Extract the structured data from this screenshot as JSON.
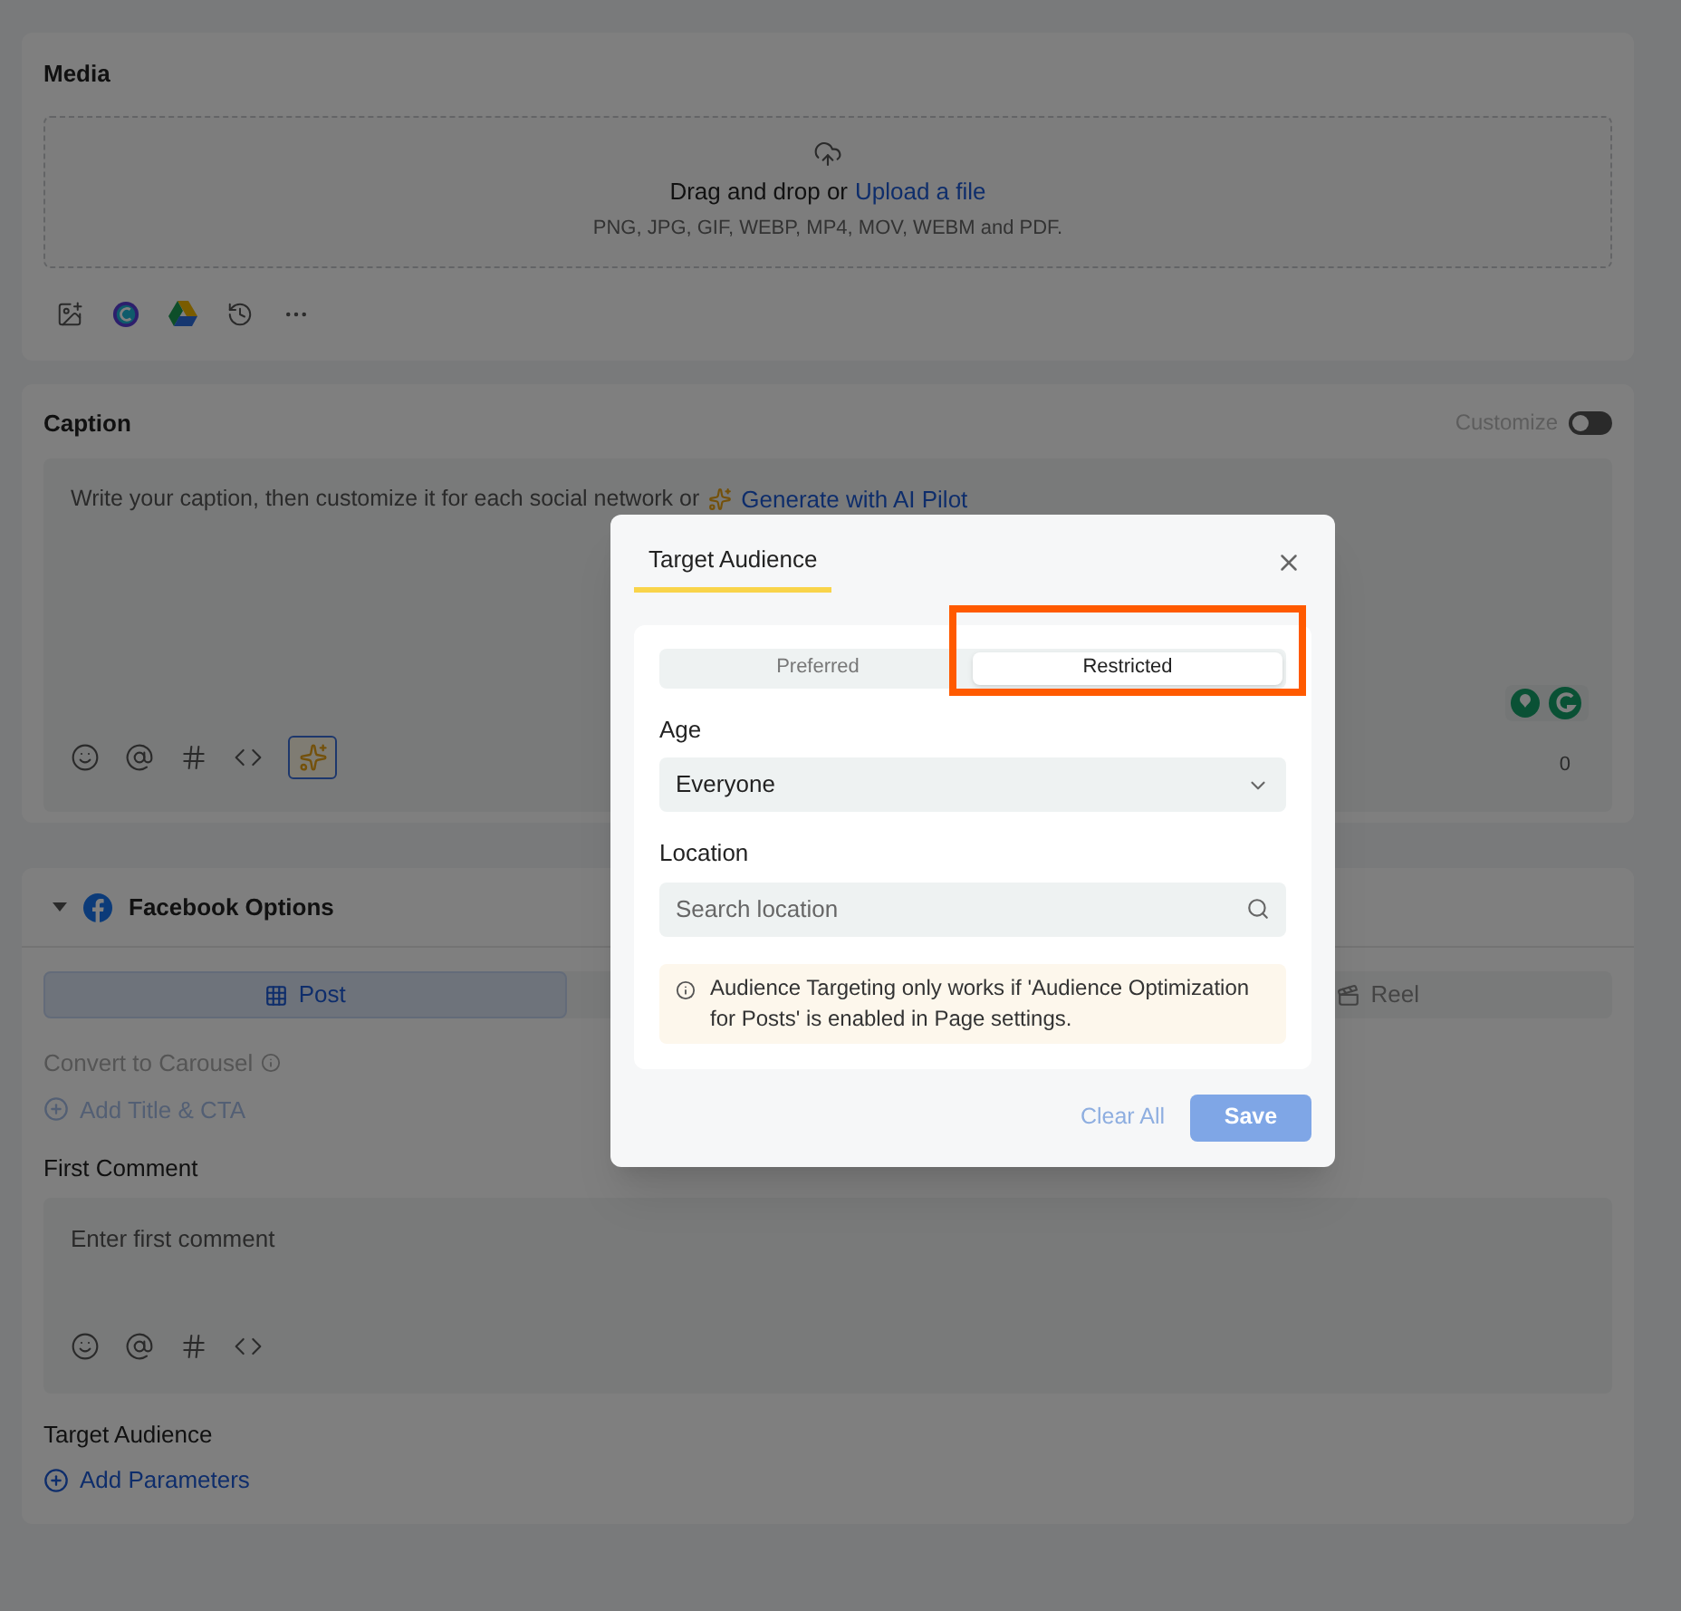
{
  "media": {
    "title": "Media",
    "dropzone": {
      "prompt": "Drag and drop or",
      "link": "Upload a file",
      "formats": "PNG, JPG, GIF, WEBP, MP4, MOV, WEBM and PDF."
    }
  },
  "caption": {
    "title": "Caption",
    "customize": {
      "label": "Customize",
      "on": false
    },
    "placeholder": "Write your caption, then customize it for each social network or",
    "ai_link": "Generate with AI Pilot",
    "count": "0"
  },
  "facebook_options": {
    "title": "Facebook Options",
    "expanded": true,
    "tabs": [
      {
        "label": "Post",
        "selected": true,
        "kind": "post"
      },
      {
        "label": "Reel",
        "selected": false,
        "kind": "reel"
      }
    ],
    "convert_label": "Convert to Carousel",
    "add_title_link": "Add Title & CTA",
    "first_comment": {
      "label": "First Comment",
      "placeholder": "Enter first comment"
    },
    "target_audience": {
      "label": "Target Audience",
      "link": "Add Parameters"
    }
  },
  "dialog": {
    "title": "Target Audience",
    "segments": [
      {
        "label": "Preferred",
        "selected": false
      },
      {
        "label": "Restricted",
        "selected": true
      }
    ],
    "age": {
      "label": "Age",
      "value": "Everyone"
    },
    "location": {
      "label": "Location",
      "placeholder": "Search location"
    },
    "notice": "Audience Targeting only works if 'Audience Optimization for Posts' is enabled in Page settings.",
    "buttons": {
      "clear": "Clear All",
      "save": "Save"
    }
  }
}
